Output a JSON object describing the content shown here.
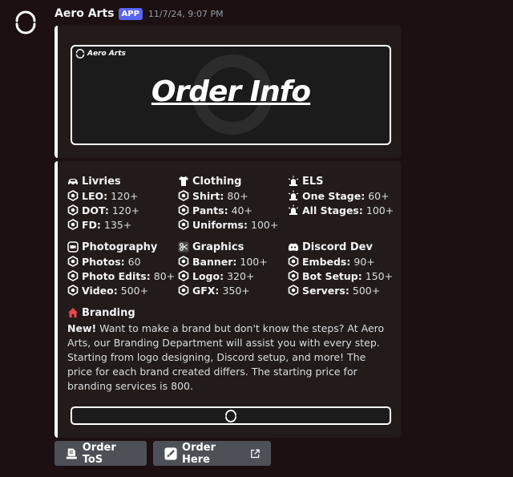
{
  "message": {
    "author": "Aero Arts",
    "badge": "APP",
    "timestamp": "11/7/24, 9:07 PM"
  },
  "banner": {
    "logo_text": "Aero Arts",
    "title": "Order Info"
  },
  "sections": {
    "livries": {
      "title": "Livries",
      "items": [
        {
          "label": "LEO:",
          "value": " 120+"
        },
        {
          "label": "DOT:",
          "value": "120+"
        },
        {
          "label": "FD:",
          "value": " 135+"
        }
      ]
    },
    "clothing": {
      "title": "Clothing",
      "items": [
        {
          "label": "Shirt:",
          "value": " 80+"
        },
        {
          "label": "Pants:",
          "value": " 40+"
        },
        {
          "label": "Uniforms:",
          "value": " 100+"
        }
      ]
    },
    "els": {
      "title": "ELS",
      "items": [
        {
          "label": "One Stage:",
          "value": " 60+"
        },
        {
          "label": "All Stages:",
          "value": " 100+"
        }
      ]
    },
    "photography": {
      "title": "Photography",
      "items": [
        {
          "label": "Photos:",
          "value": " 60"
        },
        {
          "label": "Photo Edits:",
          "value": " 80+"
        },
        {
          "label": "Video:",
          "value": " 500+"
        }
      ]
    },
    "graphics": {
      "title": "Graphics",
      "items": [
        {
          "label": "Banner:",
          "value": " 100+"
        },
        {
          "label": "Logo:",
          "value": " 320+"
        },
        {
          "label": "GFX:",
          "value": " 350+"
        }
      ]
    },
    "discord": {
      "title": "Discord Dev",
      "items": [
        {
          "label": "Embeds:",
          "value": " 90+"
        },
        {
          "label": "Bot Setup:",
          "value": " 150+"
        },
        {
          "label": "Servers:",
          "value": " 500+"
        }
      ]
    }
  },
  "branding": {
    "title": "Branding",
    "new_label": "New!",
    "text": " Want to make a brand but don't know the steps? At Aero Arts, our Branding Department will assist you with every step. Starting from logo designing, Discord setup, and more! The price for each brand created differs. The starting price for branding services is 800."
  },
  "buttons": {
    "tos": "Order ToS",
    "order": "Order Here"
  },
  "colors": {
    "background": "#1c1012",
    "embed": "#221b1a",
    "accent": "#ffffff",
    "badge": "#5865f2",
    "button": "#4e5058",
    "branding_icon": "#e5484d"
  },
  "icons": {
    "avatar": "aero-ring-icon",
    "livries": "car-icon",
    "clothing": "shirt-icon",
    "els": "siren-icon",
    "photography": "camera-icon",
    "graphics": "scissors-icon",
    "discord": "discord-icon",
    "branding": "house-icon",
    "bullet": "hexagon-bullet-icon",
    "tos": "document-icon",
    "order": "brush-icon",
    "external": "external-link-icon"
  }
}
